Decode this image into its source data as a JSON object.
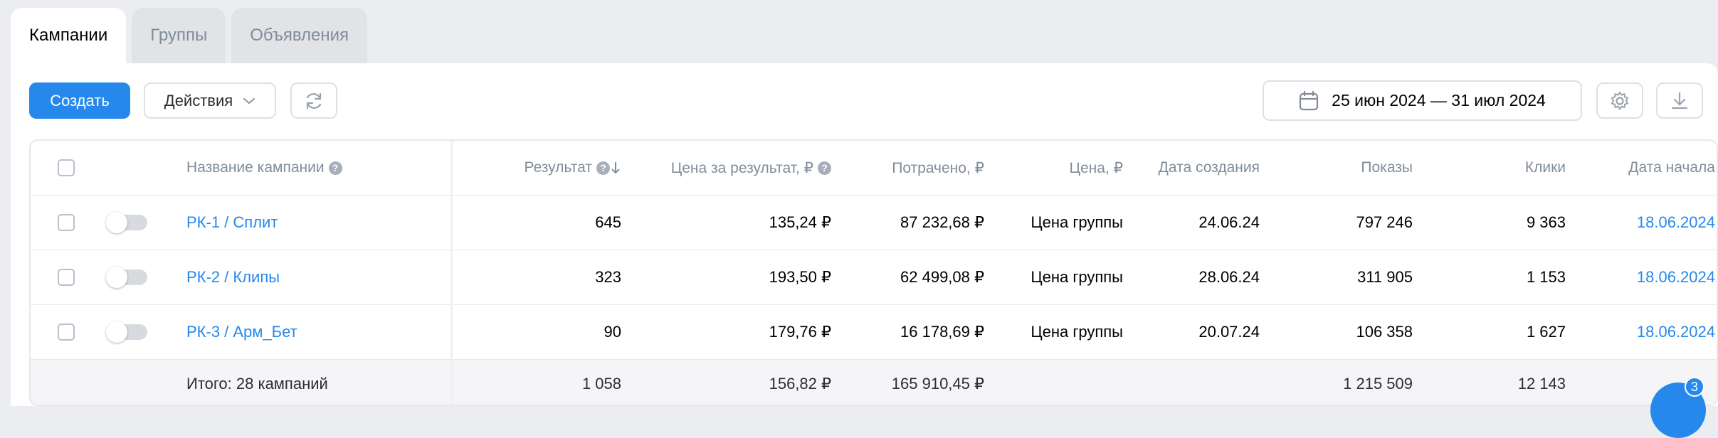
{
  "tabs": [
    {
      "label": "Кампании"
    },
    {
      "label": "Группы"
    },
    {
      "label": "Объявления"
    }
  ],
  "toolbar": {
    "create_label": "Создать",
    "actions_label": "Действия",
    "date_range": "25 июн 2024 — 31 июл 2024"
  },
  "table": {
    "headers": {
      "name": "Название кампании",
      "result": "Результат",
      "cost_per_result": "Цена за результат, ₽",
      "spent": "Потрачено, ₽",
      "price": "Цена, ₽",
      "created": "Дата создания",
      "impressions": "Показы",
      "clicks": "Клики",
      "start_date": "Дата начала"
    },
    "rows": [
      {
        "name": "РК-1 / Сплит",
        "result": "645",
        "cost_per_result": "135,24 ₽",
        "spent": "87 232,68 ₽",
        "price": "Цена группы",
        "created": "24.06.24",
        "impressions": "797 246",
        "clicks": "9 363",
        "start_date": "18.06.2024"
      },
      {
        "name": "РК-2 / Клипы",
        "result": "323",
        "cost_per_result": "193,50 ₽",
        "spent": "62 499,08 ₽",
        "price": "Цена группы",
        "created": "28.06.24",
        "impressions": "311 905",
        "clicks": "1 153",
        "start_date": "18.06.2024"
      },
      {
        "name": "РК-3 / Арм_Бет",
        "result": "90",
        "cost_per_result": "179,76 ₽",
        "spent": "16 178,69 ₽",
        "price": "Цена группы",
        "created": "20.07.24",
        "impressions": "106 358",
        "clicks": "1 627",
        "start_date": "18.06.2024"
      }
    ],
    "footer": {
      "label": "Итого: 28 кампаний",
      "result": "1 058",
      "cost_per_result": "156,82 ₽",
      "spent": "165 910,45 ₽",
      "impressions": "1 215 509",
      "clicks": "12 143"
    }
  },
  "chat": {
    "badge": "3"
  },
  "colors": {
    "accent": "#2688eb",
    "muted": "#818c99",
    "background": "#ebedf1"
  }
}
